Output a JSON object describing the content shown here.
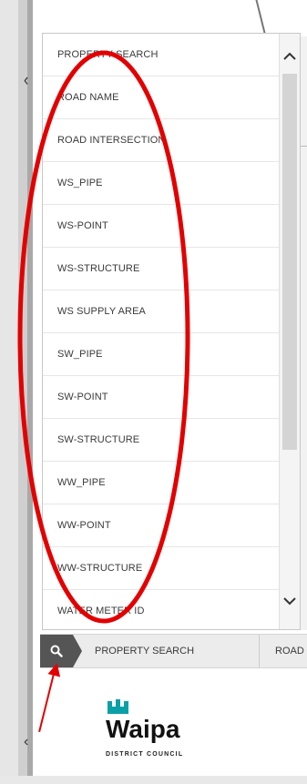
{
  "layer_list": {
    "items": [
      "PROPERTY SEARCH",
      "ROAD NAME",
      "ROAD INTERSECTION",
      "WS_PIPE",
      "WS-POINT",
      "WS-STRUCTURE",
      "WS SUPPLY AREA",
      "SW_PIPE",
      "SW-POINT",
      "SW-STRUCTURE",
      "WW_PIPE",
      "WW-POINT",
      "WW-STRUCTURE",
      "WATER METER ID"
    ]
  },
  "tabbar": {
    "tab1_label": "PROPERTY SEARCH",
    "tab2_label": "ROAD NAME"
  },
  "logo": {
    "name": "Waipa",
    "subtitle": "DISTRICT COUNCIL"
  },
  "colors": {
    "annotation": "#e30000",
    "logo_teal": "#0aa0a8"
  },
  "icons": {
    "search": "search-icon",
    "scroll_up": "chevron-up-icon",
    "scroll_down": "chevron-down-icon"
  }
}
